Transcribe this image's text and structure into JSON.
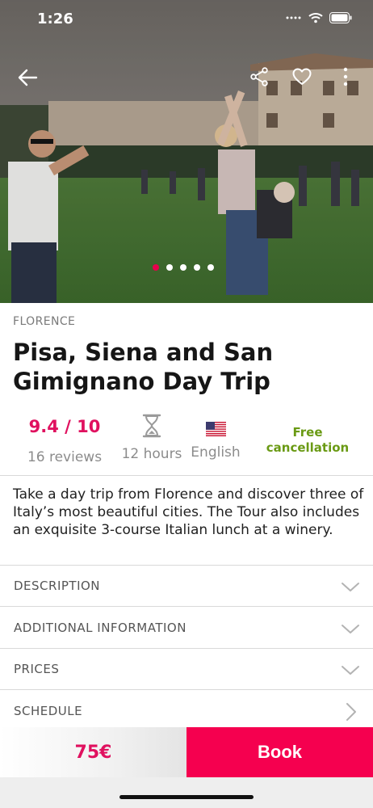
{
  "status_bar": {
    "time": "1:26"
  },
  "gallery": {
    "slide_count": 5,
    "active_index": 0
  },
  "tour": {
    "city": "FLORENCE",
    "title": "Pisa, Siena and San Gimignano Day Trip",
    "rating": "9.4 / 10",
    "reviews": "16 reviews",
    "duration": "12 hours",
    "language": "English",
    "cancellation": "Free cancellation",
    "summary": "Take a day trip from Florence and discover three of Italy’s most beautiful cities. The Tour also includes an exquisite 3-course Italian lunch at a winery."
  },
  "sections": [
    {
      "label": "DESCRIPTION",
      "icon": "chevron-down-icon"
    },
    {
      "label": "ADDITIONAL INFORMATION",
      "icon": "chevron-down-icon"
    },
    {
      "label": "PRICES",
      "icon": "chevron-down-icon"
    },
    {
      "label": "SCHEDULE",
      "icon": "chevron-right-icon"
    }
  ],
  "booking": {
    "price": "75€",
    "book_label": "Book"
  },
  "colors": {
    "accent": "#f5004f",
    "rating": "#e0115f",
    "free": "#6a9a14"
  }
}
